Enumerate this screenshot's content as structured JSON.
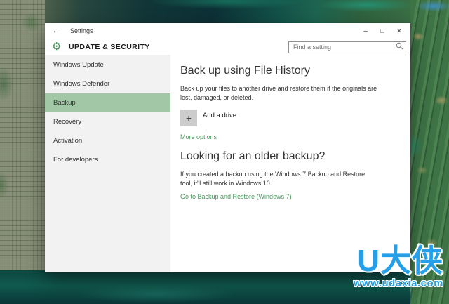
{
  "colors": {
    "accent_green": "#47985c",
    "sidebar_selected_bg": "#a1c7a6",
    "watermark_blue": "#25a0e8"
  },
  "window": {
    "titlebar": {
      "back_icon": "←",
      "title": "Settings",
      "minimize_icon": "–",
      "maximize_icon": "□",
      "close_icon": "✕"
    },
    "header": {
      "gear_icon": "⚙",
      "title": "UPDATE & SECURITY",
      "search_placeholder": "Find a setting"
    }
  },
  "sidebar": {
    "items": [
      {
        "label": "Windows Update",
        "selected": false
      },
      {
        "label": "Windows Defender",
        "selected": false
      },
      {
        "label": "Backup",
        "selected": true
      },
      {
        "label": "Recovery",
        "selected": false
      },
      {
        "label": "Activation",
        "selected": false
      },
      {
        "label": "For developers",
        "selected": false
      }
    ]
  },
  "content": {
    "file_history": {
      "heading": "Back up using File History",
      "description": "Back up your files to another drive and restore them if the originals are lost, damaged, or deleted.",
      "add_drive_icon": "+",
      "add_drive_label": "Add a drive",
      "more_options_label": "More options"
    },
    "older_backup": {
      "heading": "Looking for an older backup?",
      "description": "If you created a backup using the Windows 7 Backup and Restore tool, it'll still work in Windows 10.",
      "link_label": "Go to Backup and Restore (Windows 7)"
    }
  },
  "watermark": {
    "brand": "U大侠",
    "url": "www.udaxia.com"
  }
}
